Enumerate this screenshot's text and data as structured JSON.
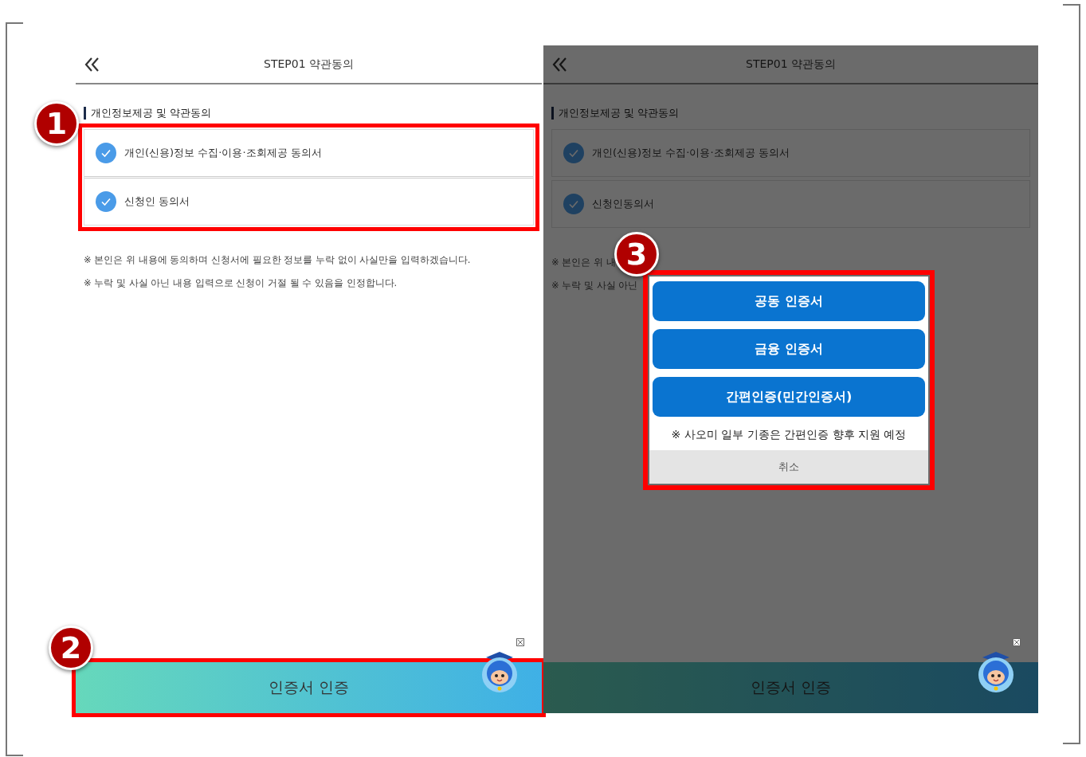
{
  "screens": [
    {
      "dimmed": false,
      "title": "STEP01 약관동의",
      "section_title": "개인정보제공 및 약관동의",
      "highlight": "1",
      "agreements": [
        {
          "label": "개인(신용)정보 수집·이용·조회제공 동의서",
          "checked": true
        },
        {
          "label": "신청인 동의서",
          "checked": true
        }
      ],
      "notices": [
        "※ 본인은 위 내용에 동의하며 신청서에 필요한 정보를 누락 없이 사실만을 입력하겠습니다.",
        "※ 누락 및 사실 아닌 내용 입력으로 신청이 거절 될 수 있음을 인정합니다."
      ],
      "bottom_button": {
        "label": "인증서 인증",
        "highlight": "2"
      }
    },
    {
      "dimmed": true,
      "title": "STEP01 약관동의",
      "section_title": "개인정보제공 및 약관동의",
      "agreements": [
        {
          "label": "개인(신용)정보 수집·이용·조회제공 동의서",
          "checked": true
        },
        {
          "label": "신청인동의서",
          "checked": true
        }
      ],
      "notices": [
        "※ 본인은 위 내",
        "※ 누락 및 사실 아닌"
      ],
      "bottom_button": {
        "label": "인증서 인증"
      },
      "modal": {
        "highlight": "3",
        "options": [
          "공동 인증서",
          "금융 인증서",
          "간편인증(민간인증서)"
        ],
        "note": "※ 사오미 일부 기종은 간편인증 향후 지원 예정",
        "cancel": "취소"
      }
    }
  ]
}
